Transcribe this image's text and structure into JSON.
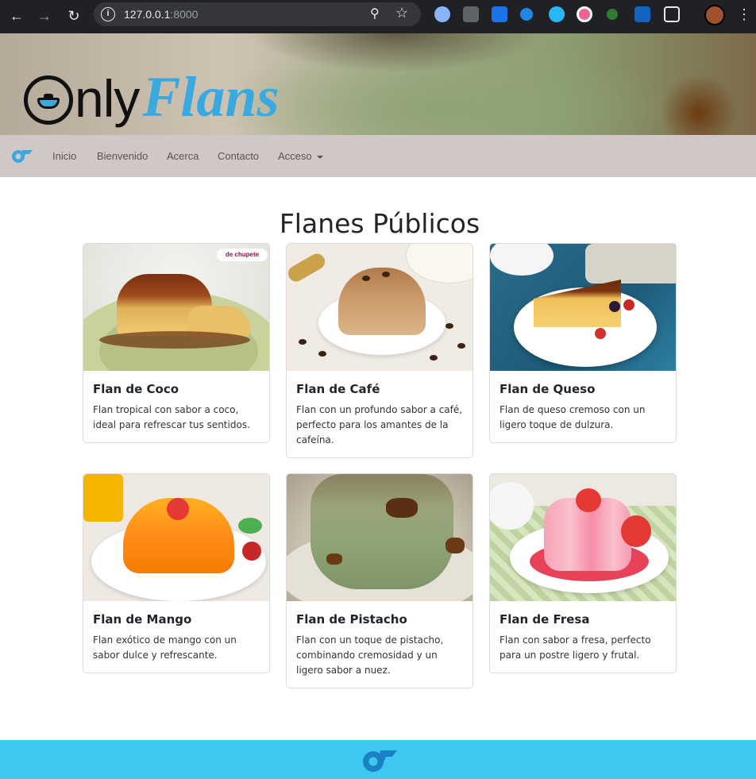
{
  "browser": {
    "url_host": "127.0.0.1",
    "url_port": ":8000"
  },
  "nav": {
    "items": [
      {
        "label": "Inicio"
      },
      {
        "label": "Bienvenido"
      },
      {
        "label": "Acerca"
      },
      {
        "label": "Contacto"
      },
      {
        "label": "Acceso"
      }
    ]
  },
  "logo": {
    "part1": "nly",
    "part2": "Flans"
  },
  "main": {
    "title": "Flanes Públicos",
    "cards": [
      {
        "title": "Flan de Coco",
        "text": "Flan tropical con sabor a coco, ideal para refrescar tus sentidos.",
        "watermark": "de chupete"
      },
      {
        "title": "Flan de Café",
        "text": "Flan con un profundo sabor a café, perfecto para los amantes de la cafeína."
      },
      {
        "title": "Flan de Queso",
        "text": "Flan de queso cremoso con un ligero toque de dulzura."
      },
      {
        "title": "Flan de Mango",
        "text": "Flan exótico de mango con un sabor dulce y refrescante."
      },
      {
        "title": "Flan de Pistacho",
        "text": "Flan con un toque de pistacho, combinando cremosidad y un ligero sabor a nuez."
      },
      {
        "title": "Flan de Fresa",
        "text": "Flan con sabor a fresa, perfecto para un postre ligero y frutal."
      }
    ]
  },
  "colors": {
    "navbar": "#d2c7c7",
    "footer": "#3cc8ef",
    "accent": "#3aa9e0"
  }
}
